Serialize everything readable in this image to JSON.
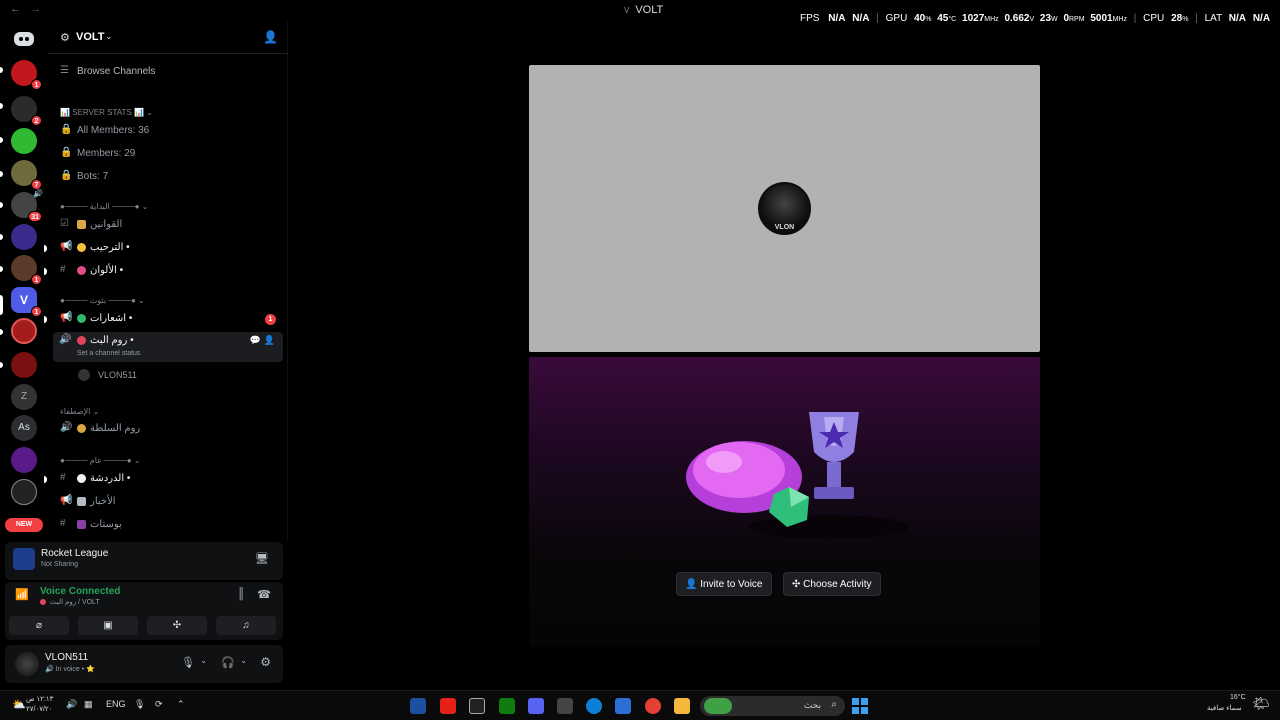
{
  "titlebar": {
    "back": "←",
    "forward": "→",
    "title": "VOLT",
    "title_prefix": "V",
    "stats": {
      "fps_label": "FPS",
      "fps_value_1": "N/A",
      "fps_value_2": "N/A",
      "gpu_label": "GPU",
      "gpu_load": "40",
      "gpu_load_unit": "%",
      "gpu_temp": "45",
      "gpu_temp_unit": "°C",
      "gpu_clock": "1027",
      "gpu_clock_unit": "MHz",
      "gpu_volt": "0.662",
      "gpu_volt_unit": "V",
      "gpu_power": "23",
      "gpu_power_unit": "W",
      "gpu_fan": "0",
      "gpu_fan_unit": "RPM",
      "gpu_mem": "5001",
      "gpu_mem_unit": "MHz",
      "cpu_label": "CPU",
      "cpu_load": "28",
      "cpu_unit": "%",
      "lat_label": "LAT",
      "lat_value_1": "N/A",
      "lat_value_2": "N/A"
    }
  },
  "guilds": {
    "new_label": "NEW",
    "items": [
      {
        "name": "discord-home",
        "color": "#5865f2",
        "badge": ""
      },
      {
        "name": "server-1",
        "color": "#c0181c",
        "badge": "1"
      },
      {
        "name": "server-2",
        "color": "#2b2b2b",
        "badge": "2"
      },
      {
        "name": "server-3",
        "color": "#2fb932",
        "badge": ""
      },
      {
        "name": "server-4",
        "color": "#6f6a3d",
        "badge": "7"
      },
      {
        "name": "server-5",
        "color": "#444444",
        "badge": "31"
      },
      {
        "name": "server-6",
        "color": "#3c2a8c",
        "badge": ""
      },
      {
        "name": "server-7",
        "color": "#5a3a2a",
        "badge": "1"
      },
      {
        "name": "server-volt",
        "color": "#4f5ce5",
        "badge": "1"
      },
      {
        "name": "server-9",
        "color": "#a31c1c",
        "badge": ""
      },
      {
        "name": "server-10",
        "color": "#7a1010",
        "badge": ""
      },
      {
        "name": "server-11",
        "color": "#333333",
        "badge": ""
      },
      {
        "name": "server-12",
        "color": "#2b2d31",
        "badge": "",
        "text": "As"
      },
      {
        "name": "server-13",
        "color": "#5a1a8a",
        "badge": ""
      },
      {
        "name": "server-14",
        "color": "#222222",
        "badge": ""
      }
    ]
  },
  "server": {
    "name": "VOLT",
    "browse_channels": "Browse Channels",
    "stats_category": "SERVER STATS",
    "all_members": "All Members: 36",
    "members": "Members: 29",
    "bots": "Bots: 7",
    "cat_start": "البداية",
    "ch_rules": "القوانين",
    "ch_welcome": "الترحيب •",
    "ch_colors": "الألوان •",
    "cat_broadcast": "بثوث",
    "ch_notifications": "اشعارات •",
    "ch_notifications_badge": "1",
    "ch_live": "روم البث •",
    "ch_live_status": "Set a channel status",
    "voice_user": "VLON511",
    "cat_chosen": "الإصطفاء",
    "ch_chosen": "روم السلطة",
    "cat_general": "عام",
    "ch_chat": "الدردشة •",
    "ch_news": "الأخبار",
    "ch_posts": "بوستات"
  },
  "game_panel": {
    "title": "Rocket League",
    "subtitle": "Not Sharing"
  },
  "voice_panel": {
    "status": "Voice Connected",
    "channel": "روم البث / VOLT"
  },
  "user_panel": {
    "name": "VLON511",
    "status": "In voice •"
  },
  "stage": {
    "avatar_tag": "VLON",
    "invite_label": "Invite to Voice",
    "activity_label": "Choose Activity"
  },
  "taskbar": {
    "lang": "ENG",
    "search_text": "بحث",
    "time": "١٢:١٣ ص",
    "date": "٢٧/٠٧/٢٠",
    "weather_temp": "16°C",
    "weather_text": "سماء صافية"
  },
  "colors": {
    "accent": "#5865f2",
    "voice_green": "#23a55a",
    "danger": "#f23f43"
  }
}
